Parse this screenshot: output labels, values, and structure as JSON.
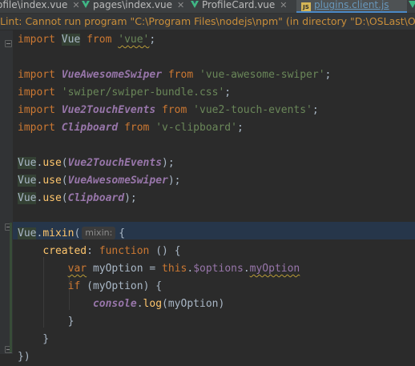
{
  "tabs": [
    {
      "label": "ofile\\index.vue",
      "icon": "vue-file-icon",
      "active": false
    },
    {
      "label": "pages\\index.vue",
      "icon": "vue-file-icon",
      "active": false
    },
    {
      "label": "ProfileCard.vue",
      "icon": "vue-file-icon",
      "active": false
    },
    {
      "label": "plugins.client.js",
      "icon": "js-file-icon",
      "active": true
    }
  ],
  "banner": {
    "text": "Lint: Cannot run program \"C:\\Program Files\\nodejs\\npm\" (in directory \"D:\\OSLast\\OSPanel\\doma"
  },
  "code": {
    "import_kw": "import",
    "from_kw": "from",
    "vue_name": "Vue",
    "vue_module": "'vue'",
    "swiper_name": "VueAwesomeSwiper",
    "swiper_module": "'vue-awesome-swiper'",
    "swiper_css": "'swiper/swiper-bundle.css'",
    "touch_name": "Vue2TouchEvents",
    "touch_module": "'vue2-touch-events'",
    "clip_name": "Clipboard",
    "clip_module": "'v-clipboard'",
    "use_fn": "use",
    "mixin_fn": "mixin",
    "mixin_hint": "mixin:",
    "created_key": "created",
    "function_kw": "function",
    "var_kw": "var",
    "my_option": "myOption",
    "this_kw": "this",
    "options_prop": "$options",
    "my_option_prop": "myOption",
    "if_kw": "if",
    "console_name": "console",
    "log_fn": "log"
  },
  "colors": {
    "background": "#2b2b2b",
    "keyword": "#cc7832",
    "string": "#6a8759",
    "import_name": "#9876aa",
    "function": "#ffc66d",
    "text": "#a9b7c6",
    "warning": "#c98e3a"
  }
}
